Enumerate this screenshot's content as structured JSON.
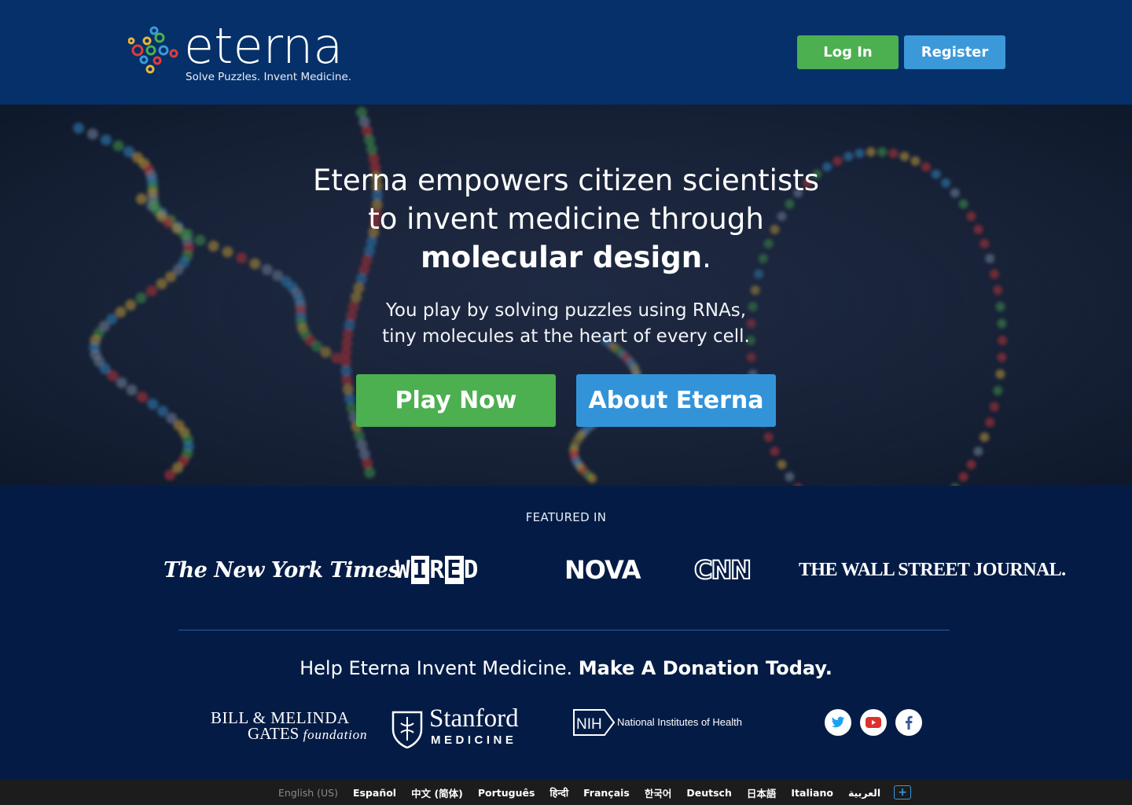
{
  "header": {
    "logo_word": "eterna",
    "logo_tagline": "Solve Puzzles.  Invent Medicine.",
    "login_label": "Log In",
    "register_label": "Register"
  },
  "hero": {
    "title_line1": "Eterna empowers citizen scientists",
    "title_line2": "to invent medicine through",
    "title_bold": "molecular design",
    "title_end": ".",
    "sub_line1": "You play by solving puzzles using RNAs,",
    "sub_line2": "tiny molecules at the heart of every cell.",
    "play_label": "Play Now",
    "about_label": "About Eterna"
  },
  "featured": {
    "label": "FEATURED IN",
    "outlets": {
      "nyt": "The New York Times",
      "wired_parts": [
        "W",
        "I",
        "R",
        "E",
        "D"
      ],
      "nova": "NOVA",
      "cnn": "CNN",
      "wsj": "THE WALL STREET JOURNAL."
    }
  },
  "donate": {
    "lead": "Help Eterna Invent Medicine. ",
    "cta": "Make A Donation Today."
  },
  "sponsors": {
    "gates_l1": "BILL & MELINDA",
    "gates_l2a": "GATES ",
    "gates_l2b": "foundation",
    "stanford_w1": "Stanford",
    "stanford_w2": "MEDICINE",
    "nih_badge": "NIH",
    "nih_text": "National Institutes of Health"
  },
  "social": [
    "twitter-icon",
    "youtube-icon",
    "facebook-icon"
  ],
  "languages": {
    "current": "English (US)",
    "others": [
      "Español",
      "中文 (简体)",
      "Português",
      "हिन्दी",
      "Français",
      "한국어",
      "Deutsch",
      "日本語",
      "Italiano",
      "العربية"
    ],
    "more": "+"
  },
  "colors": {
    "header_bg": "#053069",
    "page_bg": "#041c45",
    "green": "#4caf50",
    "blue": "#3b99d9",
    "footer_bg": "#1c1c1c"
  }
}
